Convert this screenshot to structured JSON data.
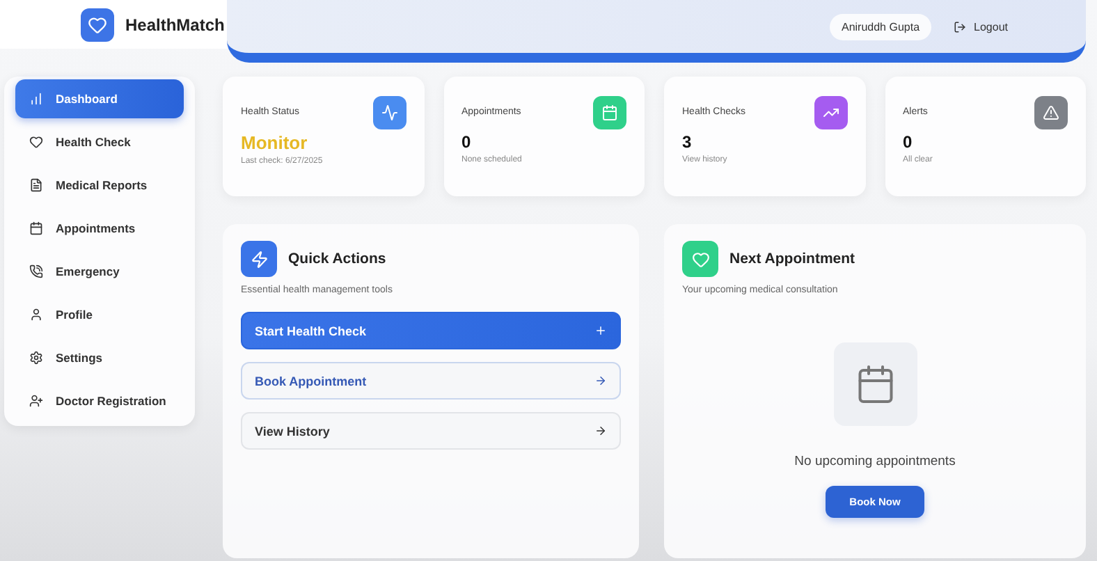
{
  "brand": {
    "name": "HealthMatch"
  },
  "header": {
    "user": "Aniruddh Gupta",
    "logout": "Logout"
  },
  "sidebar": {
    "items": [
      {
        "label": "Dashboard",
        "kind": "chart",
        "selected": true
      },
      {
        "label": "Health Check",
        "kind": "heart",
        "selected": false
      },
      {
        "label": "Medical Reports",
        "kind": "report",
        "selected": false
      },
      {
        "label": "Appointments",
        "kind": "calendar",
        "selected": false
      },
      {
        "label": "Emergency",
        "kind": "phone",
        "selected": false
      },
      {
        "label": "Profile",
        "kind": "user",
        "selected": false
      },
      {
        "label": "Settings",
        "kind": "gear",
        "selected": false
      },
      {
        "label": "Doctor Registration",
        "kind": "user-plus",
        "selected": false
      }
    ]
  },
  "stats": [
    {
      "title": "Health Status",
      "value": "Monitor",
      "note": "Last check: 6/27/2025",
      "kind": "pulse",
      "color": "#4a8cf0",
      "highlighted": true
    },
    {
      "title": "Appointments",
      "value": "0",
      "note": "None scheduled",
      "kind": "calendar",
      "color": "#2fd08a",
      "highlighted": false
    },
    {
      "title": "Health Checks",
      "value": "3",
      "note": "View history",
      "kind": "trend",
      "color": "#a55cf0",
      "highlighted": false
    },
    {
      "title": "Alerts",
      "value": "0",
      "note": "All clear",
      "kind": "alert",
      "color": "#7d8188",
      "highlighted": false
    }
  ],
  "quick_actions": {
    "title": "Quick Actions",
    "subtitle": "Essential health management tools",
    "actions": [
      {
        "label": "Start Health Check",
        "kind": "primary"
      },
      {
        "label": "Book Appointment",
        "kind": "outline"
      },
      {
        "label": "View History",
        "kind": "plain"
      }
    ]
  },
  "next_appointment": {
    "title": "Next Appointment",
    "subtitle": "Your upcoming medical consultation",
    "empty": "No upcoming appointments",
    "button": "Book Now"
  }
}
